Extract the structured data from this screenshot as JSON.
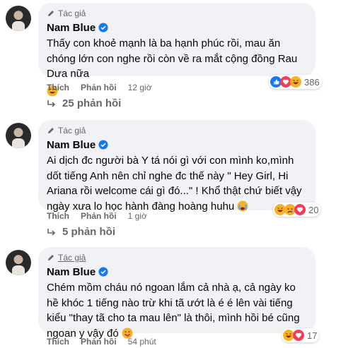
{
  "comments": [
    {
      "badge": "Tác giả",
      "author": "Nam Blue",
      "text": "Thấy con khoẻ mạnh là ba hạnh phúc rồi, mau ăn chóng lớn con nghe rồi còn về ra mắt cộng đồng Rau Dưa nữa",
      "like": "Thích",
      "reply": "Phản hồi",
      "time": "12 giờ",
      "reaction_count": "386",
      "reaction_icons": [
        "like",
        "love",
        "haha"
      ],
      "replies_label": "25 phản hồi"
    },
    {
      "badge": "Tác giả",
      "author": "Nam Blue",
      "text": "Ai dịch đc người bà Y tá nói gì với con mình ko,mình dốt tiếng Anh nên chỉ nghe đc thế này \" Hey Girl, Hi Ariana rồi welcome cái gì đó...\" ! Khổ thật chứ biết vậy ngày xưa lo học hành đàng hoàng huhu",
      "like": "Thích",
      "reply": "Phản hồi",
      "time": "1 giờ",
      "reaction_count": "20",
      "reaction_icons": [
        "haha",
        "sad",
        "love"
      ],
      "replies_label": "5 phản hồi"
    },
    {
      "badge": "Tác giả",
      "author": "Nam Blue",
      "text": "Chém mồm cháu nó ngoan lắm cả nhà ạ, cả ngày ko hề khóc 1 tiếng nào trừ khi tã ướt là é é lên vài tiếng kiểu \"thay tã cho ta mau lên\" là thôi, mình hồi bé cũng ngoan y vậy đó",
      "like": "Thích",
      "reply": "Phản hồi",
      "time": "54 phút",
      "reaction_count": "17",
      "reaction_icons": [
        "haha",
        "love"
      ]
    }
  ],
  "icons": {
    "author_badge": "pen-icon",
    "verified": "verified-badge-icon",
    "replies_arrow": "reply-arrow-icon"
  },
  "colors": {
    "bubble": "#f0f2f5",
    "secondary_text": "#65676b",
    "verified": "#1877f2",
    "like": "#1877f2",
    "love": "#f33e58",
    "haha": "#f7b125"
  }
}
